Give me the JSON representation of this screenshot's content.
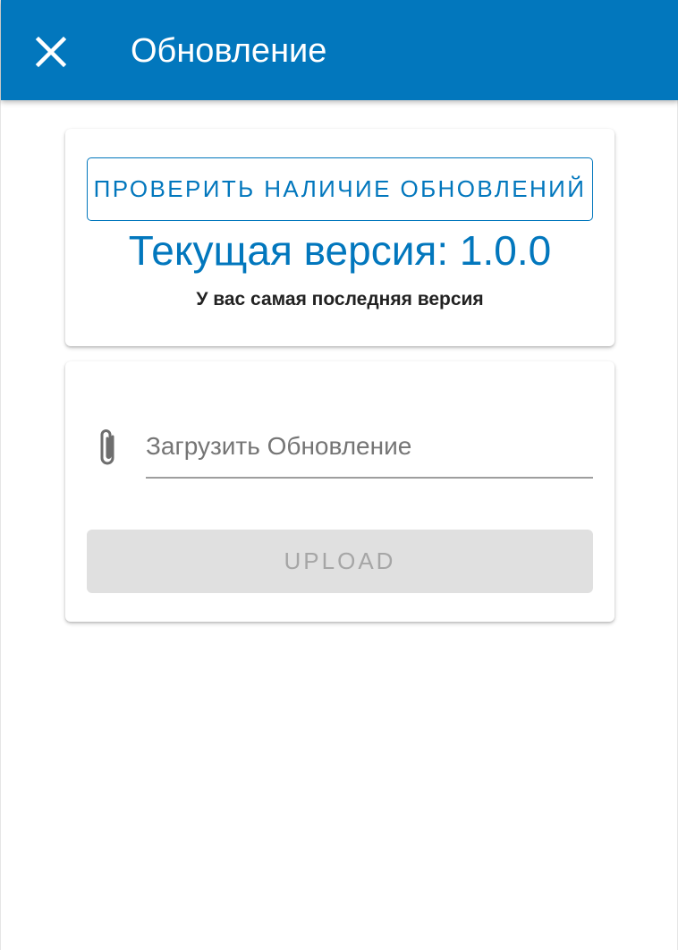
{
  "appbar": {
    "title": "Обновление",
    "close_icon": "close-icon",
    "background": "#0277bd"
  },
  "version_card": {
    "check_button_label": "ПРОВЕРИТЬ НАЛИЧИЕ ОБНОВЛЕНИЙ",
    "current_version": "Текущая версия: 1.0.0",
    "status": "У вас самая последняя версия"
  },
  "upload_card": {
    "attach_icon": "paperclip-icon",
    "file_placeholder": "Загрузить Обновление",
    "upload_button_label": "UPLOAD",
    "upload_button_disabled": true
  },
  "colors": {
    "accent": "#0277bd",
    "disabled_bg": "#e0e0e0",
    "disabled_text": "#a6a6a6"
  }
}
